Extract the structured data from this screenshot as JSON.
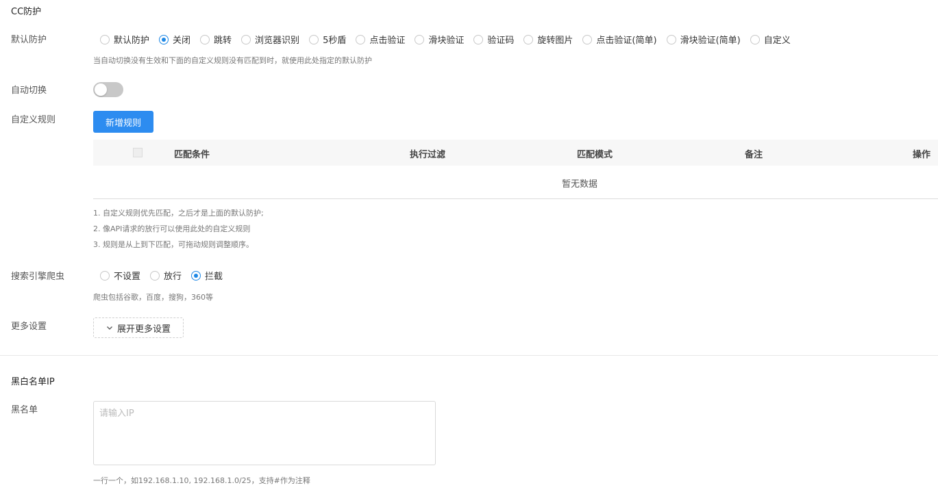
{
  "cc": {
    "title": "CC防护",
    "default_protection": {
      "label": "默认防护",
      "options": [
        "默认防护",
        "关闭",
        "跳转",
        "浏览器识别",
        "5秒盾",
        "点击验证",
        "滑块验证",
        "验证码",
        "旋转图片",
        "点击验证(简单)",
        "滑块验证(简单)",
        "自定义"
      ],
      "selected": "关闭",
      "hint": "当自动切换没有生效和下面的自定义规则没有匹配到时，就使用此处指定的默认防护"
    },
    "auto_switch": {
      "label": "自动切换",
      "enabled": false
    },
    "custom_rules": {
      "label": "自定义规则",
      "add_button": "新增规则",
      "columns": [
        "匹配条件",
        "执行过滤",
        "匹配模式",
        "备注",
        "操作"
      ],
      "empty_text": "暂无数据",
      "notes": [
        "1. 自定义规则优先匹配，之后才是上面的默认防护;",
        "2. 像API请求的放行可以使用此处的自定义规则",
        "3. 规则是从上到下匹配，可拖动规则调整顺序。"
      ]
    },
    "search_engine": {
      "label": "搜索引擎爬虫",
      "options": [
        "不设置",
        "放行",
        "拦截"
      ],
      "selected": "拦截",
      "hint": "爬虫包括谷歌，百度，搜狗，360等"
    },
    "more_settings": {
      "label": "更多设置",
      "button": "展开更多设置"
    }
  },
  "ip_list": {
    "title": "黑白名单IP",
    "blacklist": {
      "label": "黑名单",
      "placeholder": "请输入IP",
      "value": "",
      "hint": "一行一个，如192.168.1.10, 192.168.1.0/25，支持#作为注释"
    }
  },
  "colors": {
    "accent": "#2d8cf0",
    "radio_active": "#1e88e5",
    "toggle_off": "#c8c8c8"
  },
  "icons": {
    "expand": "chevron-down-icon"
  }
}
